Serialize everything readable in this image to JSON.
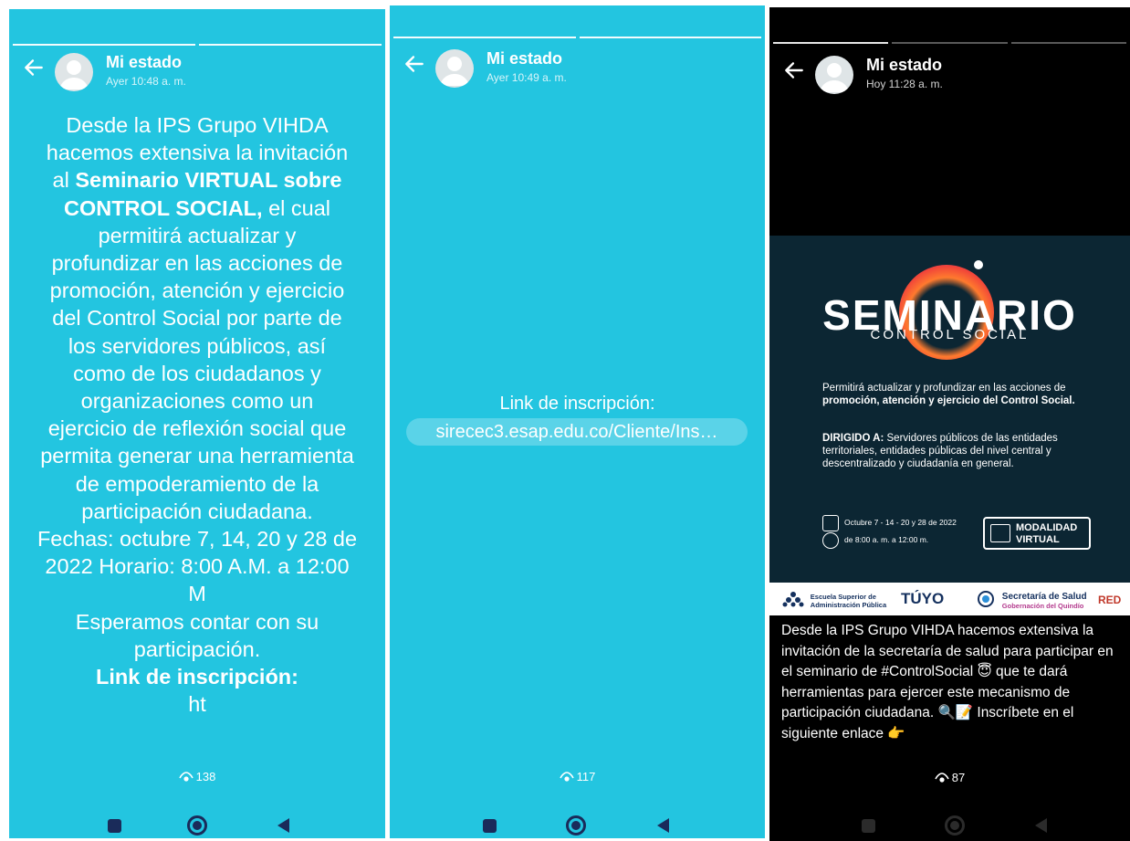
{
  "panels": [
    {
      "contact": "Mi estado",
      "time": "Ayer 10:48 a. m.",
      "text_lines": [
        "Desde la IPS Grupo VIHDA",
        "hacemos extensiva la invitación",
        "al",
        "Seminario VIRTUAL sobre",
        "CONTROL SOCIAL,",
        "el cual",
        "permitirá actualizar y",
        "profundizar en las acciones de",
        "promoción, atención y ejercicio",
        "del Control Social por parte de",
        "los servidores públicos, así",
        "como de los ciudadanos y",
        "organizaciones como un",
        "ejercicio de reflexión social que",
        "permita generar una herramienta",
        "de empoderamiento de la",
        "participación ciudadana.",
        "Fechas: octubre 7, 14, 20 y 28 de",
        "2022 Horario: 8:00 A.M. a 12:00",
        "M",
        "Esperamos contar con su",
        "participación.",
        "Link de inscripción:",
        "ht"
      ],
      "views": "138"
    },
    {
      "contact": "Mi estado",
      "time": "Ayer 10:49 a. m.",
      "link_label": "Link de inscripción:",
      "link_url": "sirecec3.esap.edu.co/Cliente/Ins…",
      "views": "117"
    },
    {
      "contact": "Mi estado",
      "time": "Hoy 11:28 a. m.",
      "poster": {
        "title": "SEMINARIO",
        "subtitle": "CONTROL SOCIAL",
        "desc_normal": "Permitirá actualizar y profundizar en las acciones de",
        "desc_bold": "promoción, atención y ejercicio del Control Social.",
        "target_label": "DIRIGIDO A:",
        "target_text": "Servidores públicos de las entidades territoriales, entidades públicas del nivel central y descentralizado y ciudadanía en general.",
        "dates": "Octubre 7 - 14 - 20 y 28 de 2022",
        "hours": "de 8:00 a. m. a 12:00 m.",
        "modality_1": "MODALIDAD",
        "modality_2": "VIRTUAL",
        "logo_esap_1": "Escuela Superior de",
        "logo_esap_2": "Administración Pública",
        "logo_tuyo": "TÚYO",
        "logo_salud": "Secretaría de Salud",
        "logo_salud_sub": "Gobernación del Quindío",
        "logo_red": "RED"
      },
      "caption": "Desde la IPS Grupo VIHDA hacemos extensiva la invitación de la secretaría de salud para participar en el seminario de #ControlSocial 😇 que te dará herramientas para ejercer este mecanismo de participación ciudadana. 🔍📝 Inscríbete en el siguiente enlace 👉",
      "views": "87"
    }
  ],
  "colors": {
    "status_bg": "#23c5e0",
    "dark_bg": "#000000",
    "poster_bg": "#0c2633"
  },
  "icons": [
    "back-arrow-icon",
    "avatar-icon",
    "eye-icon",
    "nav-recents-icon",
    "nav-home-icon",
    "nav-back-icon"
  ]
}
